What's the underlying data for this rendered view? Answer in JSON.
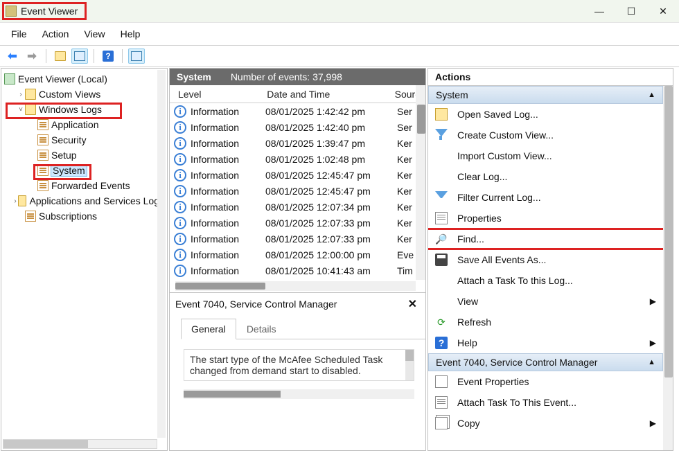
{
  "window": {
    "title": "Event Viewer"
  },
  "menubar": [
    "File",
    "Action",
    "View",
    "Help"
  ],
  "tree": {
    "root": "Event Viewer (Local)",
    "items": [
      {
        "label": "Custom Views",
        "indent": 1,
        "tog": "›",
        "icon": "folder"
      },
      {
        "label": "Windows Logs",
        "indent": 1,
        "tog": "˅",
        "icon": "folder",
        "hl": true
      },
      {
        "label": "Application",
        "indent": 2,
        "tog": "",
        "icon": "log"
      },
      {
        "label": "Security",
        "indent": 2,
        "tog": "",
        "icon": "log"
      },
      {
        "label": "Setup",
        "indent": 2,
        "tog": "",
        "icon": "log"
      },
      {
        "label": "System",
        "indent": 2,
        "tog": "",
        "icon": "log",
        "sel": true,
        "hl2": true
      },
      {
        "label": "Forwarded Events",
        "indent": 2,
        "tog": "",
        "icon": "log"
      },
      {
        "label": "Applications and Services Logs",
        "indent": 1,
        "tog": "›",
        "icon": "folder"
      },
      {
        "label": "Subscriptions",
        "indent": 1,
        "tog": "",
        "icon": "log"
      }
    ]
  },
  "grid": {
    "title": "System",
    "count_label": "Number of events: 37,998",
    "cols": [
      "Level",
      "Date and Time",
      "Source"
    ],
    "rows": [
      {
        "level": "Information",
        "dt": "08/01/2025 1:42:42 pm",
        "src": "Ser"
      },
      {
        "level": "Information",
        "dt": "08/01/2025 1:42:40 pm",
        "src": "Ser"
      },
      {
        "level": "Information",
        "dt": "08/01/2025 1:39:47 pm",
        "src": "Ker"
      },
      {
        "level": "Information",
        "dt": "08/01/2025 1:02:48 pm",
        "src": "Ker"
      },
      {
        "level": "Information",
        "dt": "08/01/2025 12:45:47 pm",
        "src": "Ker"
      },
      {
        "level": "Information",
        "dt": "08/01/2025 12:45:47 pm",
        "src": "Ker"
      },
      {
        "level": "Information",
        "dt": "08/01/2025 12:07:34 pm",
        "src": "Ker"
      },
      {
        "level": "Information",
        "dt": "08/01/2025 12:07:33 pm",
        "src": "Ker"
      },
      {
        "level": "Information",
        "dt": "08/01/2025 12:07:33 pm",
        "src": "Ker"
      },
      {
        "level": "Information",
        "dt": "08/01/2025 12:00:00 pm",
        "src": "Eve"
      },
      {
        "level": "Information",
        "dt": "08/01/2025 10:41:43 am",
        "src": "Tim"
      }
    ]
  },
  "detail": {
    "title": "Event 7040, Service Control Manager",
    "tabs": [
      "General",
      "Details"
    ],
    "text": "The start type of the McAfee Scheduled Task changed from demand start to disabled."
  },
  "actions": {
    "title": "Actions",
    "section1": {
      "title": "System",
      "items": [
        {
          "label": "Open Saved Log...",
          "icon": "folder"
        },
        {
          "label": "Create Custom View...",
          "icon": "funnel"
        },
        {
          "label": "Import Custom View...",
          "icon": "blank"
        },
        {
          "label": "Clear Log...",
          "icon": "blank"
        },
        {
          "label": "Filter Current Log...",
          "icon": "filter"
        },
        {
          "label": "Properties",
          "icon": "prop"
        },
        {
          "label": "Find...",
          "icon": "find",
          "hl": true
        },
        {
          "label": "Save All Events As...",
          "icon": "save"
        },
        {
          "label": "Attach a Task To this Log...",
          "icon": "blank"
        },
        {
          "label": "View",
          "icon": "blank",
          "sub": true
        },
        {
          "label": "Refresh",
          "icon": "refresh"
        },
        {
          "label": "Help",
          "icon": "help",
          "sub": true
        }
      ]
    },
    "section2": {
      "title": "Event 7040, Service Control Manager",
      "items": [
        {
          "label": "Event Properties",
          "icon": "event"
        },
        {
          "label": "Attach Task To This Event...",
          "icon": "prop"
        },
        {
          "label": "Copy",
          "icon": "copy",
          "sub": true
        }
      ]
    }
  }
}
